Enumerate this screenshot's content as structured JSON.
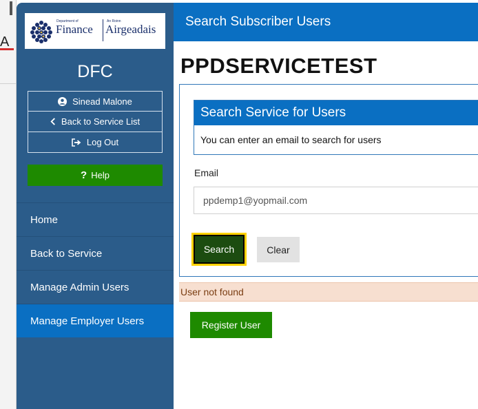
{
  "background": {
    "glyph": "A"
  },
  "logo": {
    "dept_small": "Department of",
    "dept_big": "Finance",
    "irish_small": "An Roinn",
    "irish_big": "Airgeadais"
  },
  "org": "DFC",
  "user_menu": {
    "user_name": "Sinead Malone",
    "back": "Back to Service List",
    "logout": "Log Out",
    "help": "Help"
  },
  "nav": {
    "items": [
      {
        "label": "Home"
      },
      {
        "label": "Back to Service"
      },
      {
        "label": "Manage Admin Users"
      },
      {
        "label": "Manage Employer Users"
      }
    ],
    "active_index": 3
  },
  "header": {
    "title": "Search Subscriber Users"
  },
  "page": {
    "title": "PPDSERVICETEST"
  },
  "search_card": {
    "title": "Search Service for Users",
    "description": "You can enter an email to search for users"
  },
  "form": {
    "email_label": "Email",
    "email_value": "ppdemp1@yopmail.com",
    "search_label": "Search",
    "clear_label": "Clear"
  },
  "alert": {
    "message": "User not found"
  },
  "register": {
    "label": "Register User"
  },
  "colors": {
    "sidebar": "#2b5c8a",
    "primary_blue": "#0a6fc2",
    "green": "#1e8a00",
    "focus_yellow": "#ffd200",
    "alert_bg": "#f7dfd0"
  },
  "icons": {
    "user": "user-circle-icon",
    "back": "chevron-left-icon",
    "logout": "sign-out-icon",
    "help": "question-icon"
  }
}
